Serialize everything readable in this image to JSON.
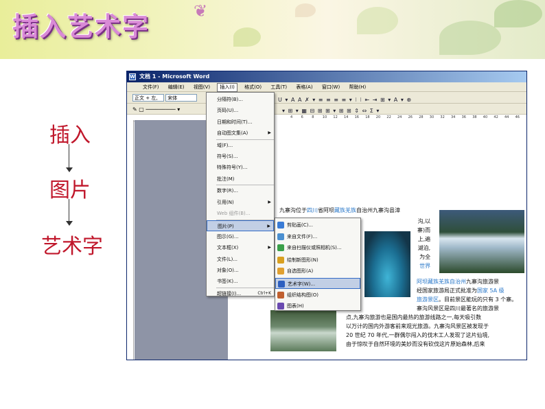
{
  "slide": {
    "title": "插入艺术字",
    "flow": [
      "插入",
      "图片",
      "艺术字"
    ]
  },
  "window": {
    "title": "文档 1 - Microsoft Word",
    "menubar": [
      "文件(F)",
      "编辑(E)",
      "视图(V)",
      "插入(I)",
      "格式(O)",
      "工具(T)",
      "表格(A)",
      "窗口(W)",
      "帮助(H)"
    ],
    "active_menu_index": 3,
    "toolbar": {
      "style": "正文 + 左,",
      "font": "宋体"
    },
    "ruler_ticks": [
      "4",
      "6",
      "8",
      "10",
      "12",
      "14",
      "16",
      "18",
      "20",
      "22",
      "24",
      "26",
      "28",
      "30",
      "32",
      "34",
      "36",
      "38",
      "40",
      "42",
      "44",
      "46"
    ]
  },
  "insert_menu": {
    "items": [
      {
        "label": "分隔符(B)...",
        "sub": false,
        "dim": false
      },
      {
        "label": "页码(U)...",
        "sub": false,
        "dim": false
      },
      {
        "label": "日期和时间(T)...",
        "sub": false,
        "dim": false
      },
      {
        "label": "自动图文集(A)",
        "sub": true,
        "dim": false
      },
      {
        "label": "域(F)...",
        "sub": false,
        "dim": false
      },
      {
        "label": "符号(S)...",
        "sub": false,
        "dim": false
      },
      {
        "label": "特殊符号(Y)...",
        "sub": false,
        "dim": false
      },
      {
        "label": "批注(M)",
        "sub": false,
        "dim": false
      },
      {
        "label": "数字(R)...",
        "sub": false,
        "dim": false
      },
      {
        "label": "引用(N)",
        "sub": true,
        "dim": false
      },
      {
        "label": "Web 组件(B)...",
        "sub": false,
        "dim": true
      },
      {
        "label": "图片(P)",
        "sub": true,
        "dim": false,
        "highlight": true
      },
      {
        "label": "图示(G)...",
        "sub": false,
        "dim": false
      },
      {
        "label": "文本框(X)",
        "sub": true,
        "dim": false
      },
      {
        "label": "文件(L)...",
        "sub": false,
        "dim": false
      },
      {
        "label": "对象(O)...",
        "sub": false,
        "dim": false
      },
      {
        "label": "书签(K)...",
        "sub": false,
        "dim": false
      },
      {
        "label": "超链接(I)...",
        "shortcut": "Ctrl+K",
        "sub": false,
        "dim": false
      }
    ]
  },
  "picture_submenu": {
    "items": [
      {
        "label": "剪贴画(C)...",
        "color": "#3a7bd5"
      },
      {
        "label": "来自文件(F)...",
        "color": "#4a8fd0"
      },
      {
        "label": "来自扫描仪或照相机(S)...",
        "color": "#3aa04a"
      },
      {
        "label": "绘制新图形(N)",
        "color": "#d9a020"
      },
      {
        "label": "自选图形(A)",
        "color": "#e0a030"
      },
      {
        "label": "艺术字(W)...",
        "color": "#2d5fc0",
        "highlight": true
      },
      {
        "label": "组织结构图(O)",
        "color": "#c06030"
      },
      {
        "label": "图表(H)",
        "color": "#6a4ab0"
      }
    ]
  },
  "document": {
    "line1": [
      "九寨沟位于",
      "四川",
      "省阿坝",
      "藏族羌族",
      "自治州九寨沟县漳"
    ],
    "right_col": [
      "沟,以",
      "寨)而",
      "上,遍",
      "湖泊,",
      "为全",
      "世界"
    ],
    "line_link": [
      "阿坝藏族羌族自治州",
      "九寨沟旅游景"
    ],
    "line_b": "经国家旅游局正式批准为",
    "line_b_link": "国家 5A 级",
    "line_c_link": "旅游景区",
    "line_c": "。目前景区能玩的只有 3 个寨。",
    "line_d": "寨沟风景区是四川最著名的旅游景",
    "left_char": "九",
    "para": [
      "点,九寨沟旅游也是国内最热的旅游线路之一,每天吸引数",
      "以万计的国内外游客前来观光旅游。九寨沟风景区被发现于",
      "20 世纪 70 年代,一群偶尔闯入的伐木工人发现了这片仙境,",
      "由于惊叹于自然环境的美妙而没有砍伐这片原始森林,后来"
    ]
  }
}
